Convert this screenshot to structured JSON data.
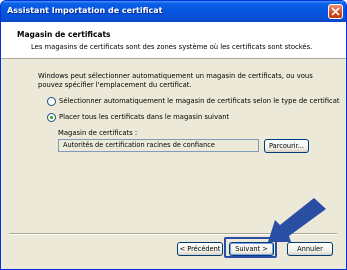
{
  "window": {
    "title": "Assistant Importation de certificat",
    "close_icon": "close-icon"
  },
  "header": {
    "title": "Magasin de certificats",
    "subtitle": "Les magasins de certificats sont des zones système où les certificats sont stockés."
  },
  "body": {
    "description": "Windows peut sélectionner automatiquement un magasin de certificats, ou vous pouvez spécifier l'emplacement du certificat.",
    "options": [
      {
        "label": "Sélectionner automatiquement le magasin de certificats selon le type de certificat",
        "checked": false
      },
      {
        "label": "Placer tous les certificats dans le magasin suivant",
        "checked": true
      }
    ],
    "store_label": "Magasin de certificats :",
    "store_value": "Autorités de certification racines de confiance",
    "browse_label": "Parcourir..."
  },
  "footer": {
    "prev_label": "< Précédent",
    "next_label": "Suivant >",
    "cancel_label": "Annuler"
  },
  "colors": {
    "titlebar": "#0554e0",
    "window_bg": "#ece9d8",
    "arrow": "#2a4ea3"
  }
}
